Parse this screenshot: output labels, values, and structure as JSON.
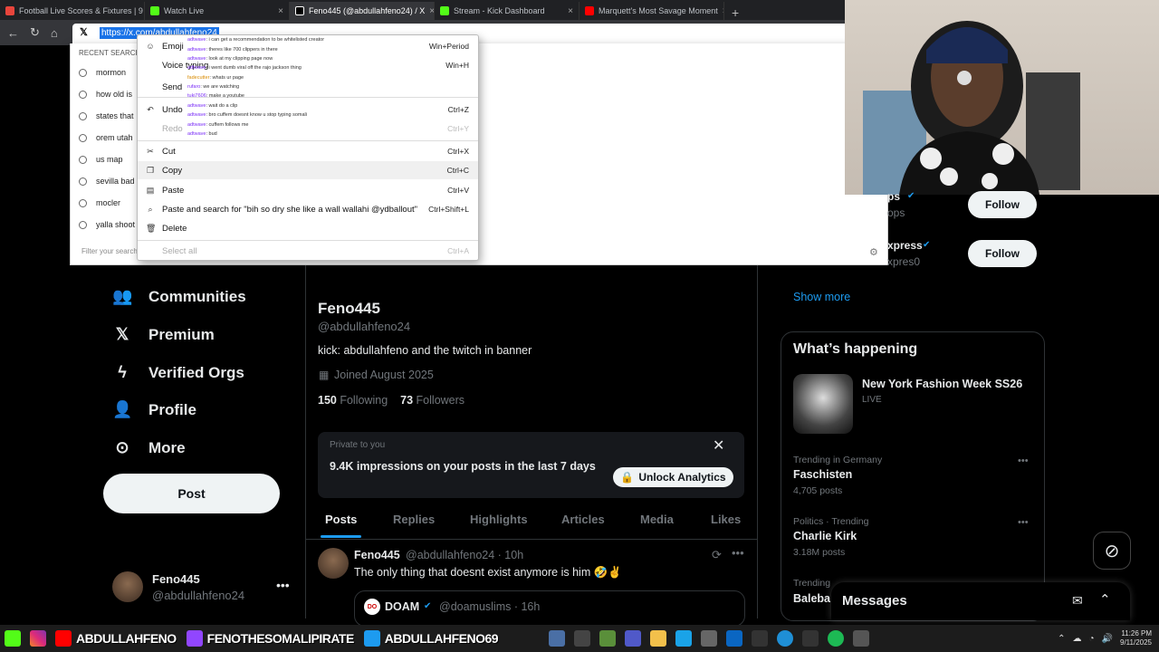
{
  "browser": {
    "tabs": [
      {
        "label": "Football Live Scores & Fixtures | 9",
        "color": "#e8453c"
      },
      {
        "label": "Watch Live",
        "color": "#53fc18"
      },
      {
        "label": "Feno445 (@abdullahfeno24) / X",
        "color": "#ffffff",
        "active": true
      },
      {
        "label": "Stream - Kick Dashboard",
        "color": "#53fc18"
      },
      {
        "label": "Marquett's Most Savage Moment",
        "color": "#ff0000"
      }
    ],
    "address_value": "https://x.com/abdullahfeno24",
    "omnibox": {
      "recent_header": "RECENT SEARCHES",
      "recent": [
        "mormon",
        "how old is",
        "states that",
        "orem utah",
        "us map",
        "sevilla bad",
        "mocler",
        "yalla shoot"
      ],
      "filter_placeholder": "Filter your searches"
    }
  },
  "context_menu": {
    "items": [
      {
        "label": "Emoji",
        "shortcut": "Win+Period",
        "icon": "emoji-icon",
        "glyph": "☺"
      },
      {
        "label": "Voice typing",
        "shortcut": "Win+H",
        "icon": "mic-icon",
        "glyph": ""
      },
      {
        "label": "Send",
        "shortcut": "",
        "icon": "send-icon",
        "glyph": ""
      },
      {
        "label": "Undo",
        "shortcut": "Ctrl+Z",
        "icon": "undo-icon",
        "glyph": "↶"
      },
      {
        "label": "Redo",
        "shortcut": "Ctrl+Y",
        "icon": "redo-icon",
        "glyph": "",
        "disabled": true
      },
      {
        "label": "Cut",
        "shortcut": "Ctrl+X",
        "icon": "cut-icon",
        "glyph": "✂"
      },
      {
        "label": "Copy",
        "shortcut": "Ctrl+C",
        "icon": "copy-icon",
        "glyph": "❐"
      },
      {
        "label": "Paste",
        "shortcut": "Ctrl+V",
        "icon": "paste-icon",
        "glyph": "▤"
      },
      {
        "label": "Paste and search for \"bih so dry she like a wall wallahi @ydballout\"",
        "shortcut": "Ctrl+Shift+L",
        "icon": "paste-search-icon",
        "glyph": "⌕"
      },
      {
        "label": "Delete",
        "shortcut": "",
        "icon": "delete-icon",
        "glyph": "🗑"
      },
      {
        "label": "Select all",
        "shortcut": "Ctrl+A",
        "icon": "",
        "glyph": "",
        "disabled": true
      }
    ]
  },
  "chat_overlay": [
    {
      "user": "adtwave",
      "msg": ": i can get a recommendation to be whitelisted creator"
    },
    {
      "user": "adtwave",
      "msg": ": theres like 700 clippers in there"
    },
    {
      "user": "adtwave",
      "msg": ": look at my clipping page now"
    },
    {
      "user": "adtwave",
      "msg": ": i went dumb viral off the rajo jackson thing"
    },
    {
      "user": "fadecutter",
      "msg": ": whats ur page"
    },
    {
      "user": "rufaro",
      "msg": ": we are watching"
    },
    {
      "user": "tuki7606",
      "msg": ": make a youtube"
    },
    {
      "user": "adtwave",
      "msg": ": wait do a clip"
    },
    {
      "user": "adtwave",
      "msg": ": bro cuffem doesnt know u stop typing somali"
    },
    {
      "user": "adtwave",
      "msg": ": cuffem follows me"
    },
    {
      "user": "adtwave",
      "msg": ": bud"
    }
  ],
  "left_nav": {
    "items": [
      {
        "label": "Communities",
        "icon": "communities-icon",
        "glyph": "👥"
      },
      {
        "label": "Premium",
        "icon": "x-logo-icon",
        "glyph": "𝕏"
      },
      {
        "label": "Verified Orgs",
        "icon": "lightning-icon",
        "glyph": "ϟ"
      },
      {
        "label": "Profile",
        "icon": "profile-icon",
        "glyph": "👤"
      },
      {
        "label": "More",
        "icon": "more-icon",
        "glyph": "⊙"
      }
    ],
    "post_label": "Post",
    "account": {
      "name": "Feno445",
      "handle": "@abdullahfeno24"
    }
  },
  "profile": {
    "name": "Feno445",
    "handle": "@abdullahfeno24",
    "bio": "kick: abdullahfeno and the twitch in banner",
    "joined": "Joined August 2025",
    "following_count": "150",
    "following_label": "Following",
    "followers_count": "73",
    "followers_label": "Followers",
    "promo": {
      "small": "Private to you",
      "text": "9.4K impressions on your posts in the last 7 days",
      "button": "Unlock Analytics"
    },
    "tabs": [
      "Posts",
      "Replies",
      "Highlights",
      "Articles",
      "Media",
      "Likes"
    ],
    "post": {
      "name": "Feno445",
      "handle": "@abdullahfeno24 · 10h",
      "text": "The only thing that doesnt exist anymore is him 🤣✌️"
    },
    "quoted": {
      "name": "DOAM",
      "handle": "@doamuslims · 16h"
    }
  },
  "right": {
    "who_to_follow": [
      {
        "name_fragment": "ps",
        "handle_fragment": "ops",
        "button": "Follow"
      },
      {
        "name_fragment": "xpress",
        "handle_fragment": "xpres0",
        "button": "Follow"
      }
    ],
    "show_more": "Show more",
    "happening_title": "What’s happening",
    "event": {
      "title": "New York Fashion Week SS26",
      "status": "LIVE"
    },
    "trends": [
      {
        "context": "Trending in Germany",
        "title": "Faschisten",
        "posts": "4,705 posts"
      },
      {
        "context": "Politics · Trending",
        "title": "Charlie Kirk",
        "posts": "3.18M posts"
      },
      {
        "context": "Trending",
        "title": "Baleba",
        "posts": ""
      }
    ],
    "messages_label": "Messages"
  },
  "taskbar": {
    "overlay": [
      "ABDULLAHFENO",
      "FENOTHESOMALIPIRATE",
      "ABDULLAHFENO69"
    ],
    "time": "11:26 PM",
    "date": "9/11/2025"
  }
}
